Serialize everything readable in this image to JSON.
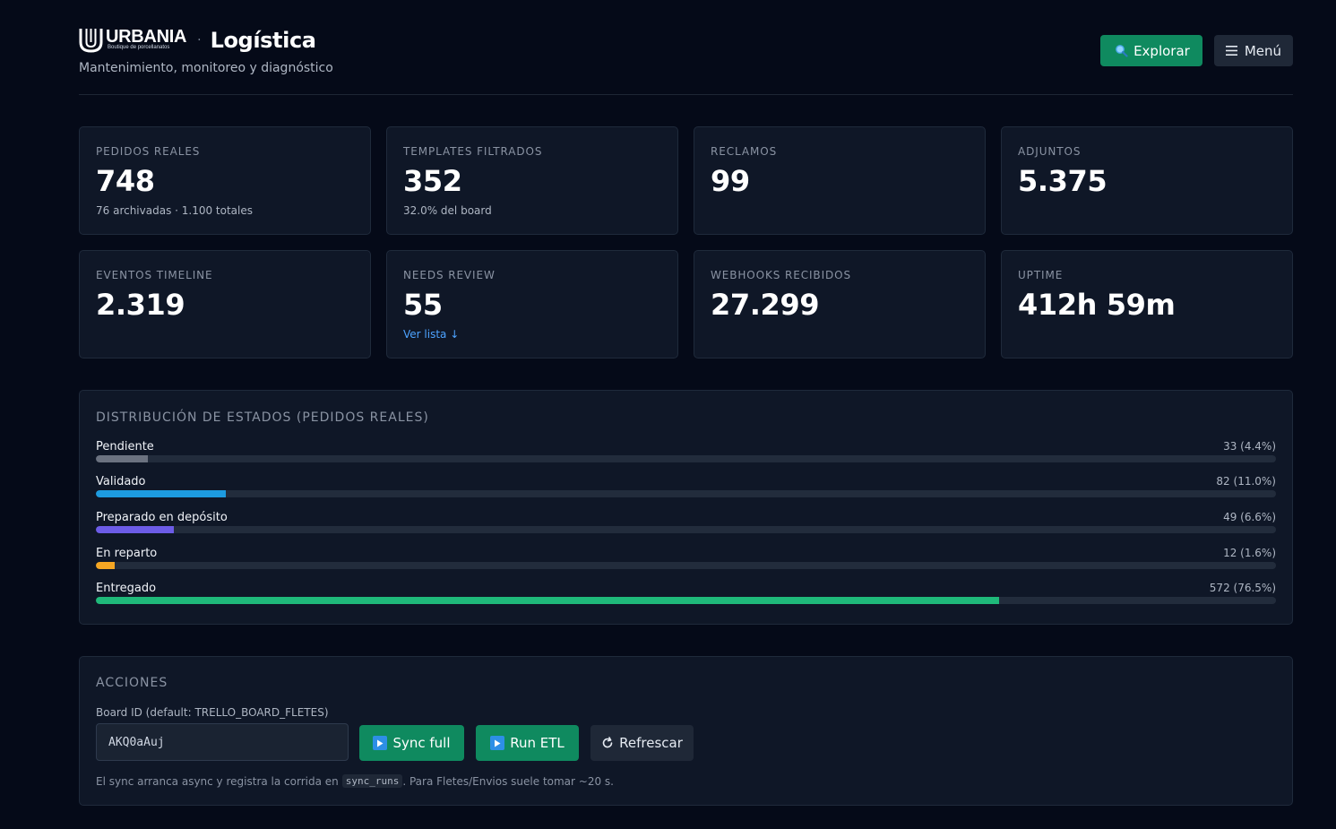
{
  "header": {
    "logo_word": "URBANIA",
    "logo_tagline": "Boutique de porcellanatos",
    "separator": "·",
    "title": "Logística",
    "subtitle": "Mantenimiento, monitoreo y diagnóstico",
    "explore_label": "Explorar",
    "explore_icon": "search-icon",
    "menu_label": "Menú",
    "menu_icon": "hamburger-icon"
  },
  "stats": [
    {
      "label": "PEDIDOS REALES",
      "value": "748",
      "sub": "76 archivadas · 1.100 totales"
    },
    {
      "label": "TEMPLATES FILTRADOS",
      "value": "352",
      "sub": "32.0% del board"
    },
    {
      "label": "RECLAMOS",
      "value": "99"
    },
    {
      "label": "ADJUNTOS",
      "value": "5.375"
    },
    {
      "label": "EVENTOS TIMELINE",
      "value": "2.319"
    },
    {
      "label": "NEEDS REVIEW",
      "value": "55",
      "link": "Ver lista ↓"
    },
    {
      "label": "WEBHOOKS RECIBIDOS",
      "value": "27.299"
    },
    {
      "label": "UPTIME",
      "value": "412h 59m"
    }
  ],
  "distribution": {
    "title": "DISTRIBUCIÓN DE ESTADOS (PEDIDOS REALES)",
    "rows": [
      {
        "label": "Pendiente",
        "count_text": "33 (4.4%)",
        "percent": 4.4,
        "color": "#6b7280"
      },
      {
        "label": "Validado",
        "count_text": "82 (11.0%)",
        "percent": 11.0,
        "color": "#1d9be0"
      },
      {
        "label": "Preparado en depósito",
        "count_text": "49 (6.6%)",
        "percent": 6.6,
        "color": "#6c5ce7"
      },
      {
        "label": "En reparto",
        "count_text": "12 (1.6%)",
        "percent": 1.6,
        "color": "#f5a623"
      },
      {
        "label": "Entregado",
        "count_text": "572 (76.5%)",
        "percent": 76.5,
        "color": "#1fb97a"
      }
    ]
  },
  "actions": {
    "title": "ACCIONES",
    "board_label": "Board ID (default: TRELLO_BOARD_FLETES)",
    "board_value": "AKQ0aAuj",
    "sync_label": "Sync full",
    "etl_label": "Run ETL",
    "refresh_label": "Refrescar",
    "note_before": "El sync arranca async y registra la corrida en",
    "note_code": "sync_runs",
    "note_after": ". Para Fletes/Envios suele tomar ~20 s."
  }
}
